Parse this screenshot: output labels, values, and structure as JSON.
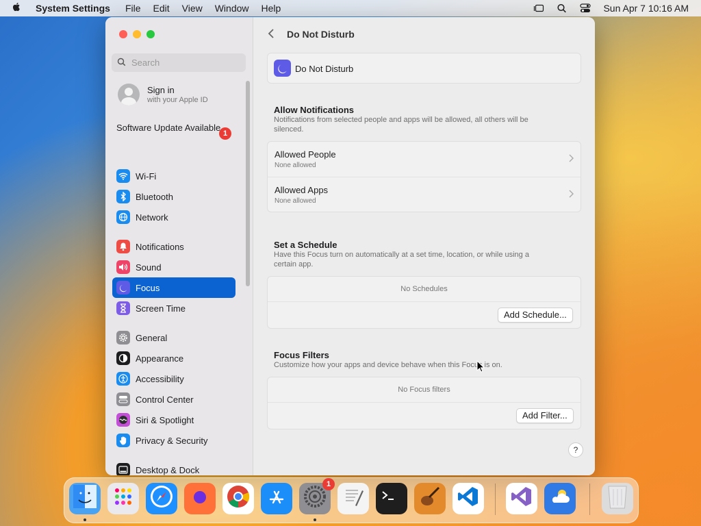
{
  "menubar": {
    "app_name": "System Settings",
    "items": [
      "File",
      "Edit",
      "View",
      "Window",
      "Help"
    ],
    "datetime": "Sun Apr 7  10:16 AM"
  },
  "window": {
    "traffic_colors": [
      "#fe5f57",
      "#febc2e",
      "#28c840"
    ]
  },
  "sidebar": {
    "search_placeholder": "Search",
    "account": {
      "title": "Sign in",
      "subtitle": "with your Apple ID"
    },
    "update": {
      "label": "Software Update Available",
      "badge": "1"
    },
    "items": [
      {
        "label": "Wi-Fi",
        "icon": "wifi-icon",
        "color": "#1a8cf0"
      },
      {
        "label": "Bluetooth",
        "icon": "bluetooth-icon",
        "color": "#1a8cf0"
      },
      {
        "label": "Network",
        "icon": "globe-icon",
        "color": "#1a8cf0"
      },
      {
        "label": "Notifications",
        "icon": "bell-icon",
        "color": "#ee4d46"
      },
      {
        "label": "Sound",
        "icon": "speaker-icon",
        "color": "#ee4468"
      },
      {
        "label": "Focus",
        "icon": "moon-icon",
        "color": "#5e5ce6"
      },
      {
        "label": "Screen Time",
        "icon": "hourglass-icon",
        "color": "#7d5ce6"
      },
      {
        "label": "General",
        "icon": "gear-icon",
        "color": "#8e8e93"
      },
      {
        "label": "Appearance",
        "icon": "appearance-icon",
        "color": "#1d1d1f"
      },
      {
        "label": "Accessibility",
        "icon": "accessibility-icon",
        "color": "#1a8cf0"
      },
      {
        "label": "Control Center",
        "icon": "control-center-icon",
        "color": "#8e8e93"
      },
      {
        "label": "Siri & Spotlight",
        "icon": "siri-icon",
        "color": "#c34fd6"
      },
      {
        "label": "Privacy & Security",
        "icon": "hand-icon",
        "color": "#1a8cf0"
      },
      {
        "label": "Desktop & Dock",
        "icon": "dock-icon",
        "color": "#1d1d1f"
      }
    ],
    "active_index": 5
  },
  "main": {
    "back_label": "<",
    "title": "Do Not Disturb",
    "focus_name": "Do Not Disturb",
    "allow": {
      "title": "Allow Notifications",
      "desc": "Notifications from selected people and apps will be allowed, all others will be silenced.",
      "rows": [
        {
          "title": "Allowed People",
          "sub": "None allowed"
        },
        {
          "title": "Allowed Apps",
          "sub": "None allowed"
        }
      ]
    },
    "schedule": {
      "title": "Set a Schedule",
      "desc": "Have this Focus turn on automatically at a set time, location, or while using a certain app.",
      "empty": "No Schedules",
      "button": "Add Schedule..."
    },
    "filters": {
      "title": "Focus Filters",
      "desc": "Customize how your apps and device behave when this Focus is on.",
      "empty": "No Focus filters",
      "button": "Add Filter..."
    },
    "help": "?"
  },
  "dock": {
    "apps": [
      {
        "name": "Finder",
        "icon": "finder-icon",
        "color": "#4aa3f2"
      },
      {
        "name": "Launchpad",
        "icon": "launchpad-icon",
        "color": "#e9e9ee"
      },
      {
        "name": "Safari",
        "icon": "safari-icon",
        "color": "#1e90ff"
      },
      {
        "name": "Firefox",
        "icon": "firefox-icon",
        "color": "#ff7139"
      },
      {
        "name": "Chrome",
        "icon": "chrome-icon",
        "color": "#ffffff"
      },
      {
        "name": "App Store",
        "icon": "app-store-icon",
        "color": "#1c8ef9"
      },
      {
        "name": "System Settings",
        "icon": "settings-icon",
        "color": "#8e8e93",
        "badge": "1"
      },
      {
        "name": "TextEdit",
        "icon": "textedit-icon",
        "color": "#f4f4f4"
      },
      {
        "name": "Terminal",
        "icon": "terminal-icon",
        "color": "#1e1e1e"
      },
      {
        "name": "GarageBand",
        "icon": "garageband-icon",
        "color": "#e38a2c"
      },
      {
        "name": "VS Code",
        "icon": "vscode-icon",
        "color": "#ffffff"
      },
      {
        "name": "Visual Studio",
        "icon": "visual-studio-icon",
        "color": "#ffffff"
      },
      {
        "name": "Weather",
        "icon": "weather-icon",
        "color": "#2f7ae5"
      },
      {
        "name": "Trash",
        "icon": "trash-icon",
        "color": "#dcdcdc"
      }
    ]
  }
}
